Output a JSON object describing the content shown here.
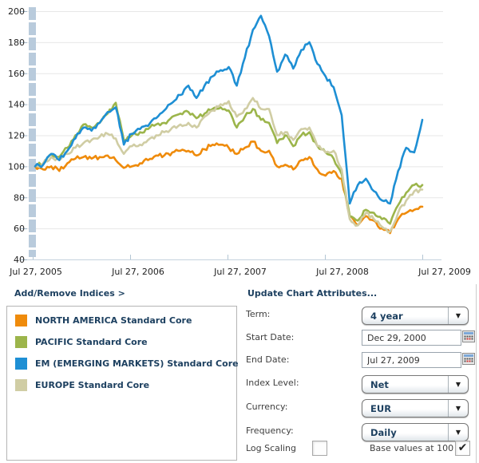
{
  "chart_data": {
    "type": "line",
    "title": "",
    "xlabel": "",
    "ylabel": "",
    "ylim": [
      40,
      200
    ],
    "y_ticks": [
      40,
      60,
      80,
      100,
      120,
      140,
      160,
      180,
      200
    ],
    "x_tick_labels": [
      "Jul 27, 2005",
      "Jul 27, 2006",
      "Jul 27, 2007",
      "Jul 27, 2008",
      "Jul 27, 2009"
    ],
    "x_unit": "months_from_start",
    "grid": true,
    "legend_position": "bottom-left",
    "base_value": 100,
    "series": [
      {
        "id": "na",
        "name": "NORTH AMERICA Standard Core",
        "color": "#ef8b0b",
        "values": [
          100,
          98,
          100,
          97,
          102,
          105,
          106,
          105,
          106,
          107,
          104,
          99,
          100,
          102,
          104,
          107,
          107,
          109,
          110,
          110,
          107,
          111,
          114,
          114,
          112,
          108,
          112,
          116,
          110,
          110,
          100,
          101,
          98,
          104,
          106,
          98,
          94,
          97,
          92,
          68,
          62,
          68,
          65,
          60,
          57,
          66,
          70,
          72,
          74
        ]
      },
      {
        "id": "pacific",
        "name": "PACIFIC Standard Core",
        "color": "#9cb54b",
        "values": [
          100,
          102,
          108,
          106,
          112,
          120,
          127,
          125,
          128,
          134,
          141,
          117,
          120,
          122,
          124,
          127,
          128,
          132,
          134,
          135,
          131,
          134,
          137,
          138,
          136,
          125,
          132,
          137,
          130,
          128,
          115,
          120,
          113,
          120,
          122,
          113,
          109,
          105,
          95,
          68,
          65,
          72,
          70,
          66,
          63,
          75,
          83,
          88,
          88
        ]
      },
      {
        "id": "europe",
        "name": "EUROPE Standard Core",
        "color": "#d0cda4",
        "values": [
          100,
          102,
          106,
          104,
          108,
          112,
          115,
          117,
          119,
          121,
          118,
          108,
          113,
          114,
          117,
          120,
          122,
          125,
          127,
          128,
          125,
          132,
          136,
          140,
          142,
          132,
          137,
          144,
          137,
          137,
          120,
          122,
          117,
          124,
          125,
          113,
          109,
          110,
          98,
          66,
          62,
          70,
          66,
          61,
          58,
          70,
          78,
          84,
          85
        ]
      },
      {
        "id": "em",
        "name": "EM (EMERGING MARKETS) Standard Core",
        "color": "#1e8fd4",
        "values": [
          100,
          101,
          108,
          104,
          110,
          118,
          125,
          123,
          128,
          135,
          138,
          114,
          121,
          124,
          126,
          131,
          136,
          141,
          146,
          152,
          144,
          152,
          158,
          162,
          164,
          152,
          170,
          188,
          197,
          184,
          161,
          172,
          163,
          175,
          180,
          166,
          158,
          151,
          133,
          76,
          88,
          92,
          84,
          78,
          76,
          97,
          112,
          109,
          130
        ]
      }
    ]
  },
  "legend": {
    "items": [
      {
        "label": "NORTH AMERICA Standard Core",
        "color": "#ef8b0b"
      },
      {
        "label": "PACIFIC Standard Core",
        "color": "#9cb54b"
      },
      {
        "label": "EM (EMERGING MARKETS) Standard Core",
        "color": "#1e8fd4"
      },
      {
        "label": "EUROPE Standard Core",
        "color": "#d0cda4"
      }
    ]
  },
  "links": {
    "add_remove_indices": "Add/Remove Indices >",
    "update_chart_attributes": "Update Chart Attributes..."
  },
  "form": {
    "term": {
      "label": "Term:",
      "value": "4 year"
    },
    "start_date": {
      "label": "Start Date:",
      "value": "Dec 29, 2000"
    },
    "end_date": {
      "label": "End Date:",
      "value": "Jul 27, 2009"
    },
    "index_level": {
      "label": "Index Level:",
      "value": "Net"
    },
    "currency": {
      "label": "Currency:",
      "value": "EUR"
    },
    "frequency": {
      "label": "Frequency:",
      "value": "Daily"
    },
    "log_scaling": {
      "label": "Log Scaling",
      "checked": false
    },
    "base_values": {
      "label": "Base values at 100",
      "checked": true
    }
  },
  "icons": {
    "dropdown_arrow": "▼",
    "checkbox_check": "✔",
    "calendar": "calendar-grid"
  },
  "colors": {
    "heading_text": "#1d4060",
    "gridline": "#e7e7e7",
    "axis_line": "#c6d3df",
    "y_tick": "#9db3c4",
    "x_tick": "#b3c6d4",
    "axis_text": "#222222",
    "scrollbar": "#b9cbdc"
  }
}
